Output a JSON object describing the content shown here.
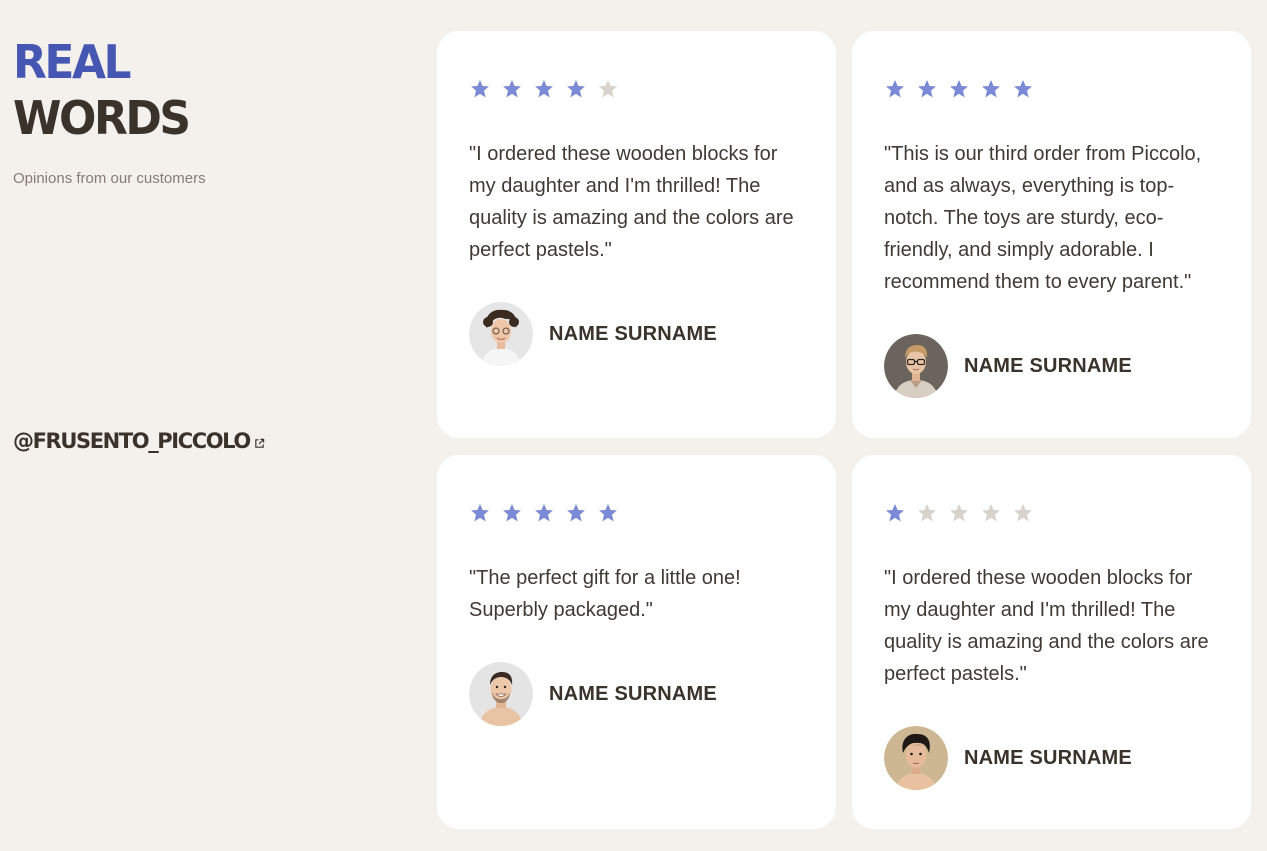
{
  "colors": {
    "background": "#f4f0ec",
    "card": "#ffffff",
    "accent": "#4657b3",
    "star_filled": "#7b8ad6",
    "star_empty": "#d7d2cc",
    "text_dark": "#3a332c",
    "text_muted": "#857d76"
  },
  "intro": {
    "title_line1": "REAL",
    "title_line2": "WORDS",
    "subtitle": "Opinions from our customers"
  },
  "social": {
    "handle": "@FRUSENTO_PICCOLO",
    "icon": "external-link-icon"
  },
  "reviews": [
    {
      "rating": 4,
      "max_rating": 5,
      "quote": "\"I ordered these wooden blocks for my daughter and I'm thrilled! The quality is amazing and the colors are perfect pastels.\"",
      "author": "NAME SURNAME",
      "avatar": "avatar-curly-hair-woman"
    },
    {
      "rating": 5,
      "max_rating": 5,
      "quote": "\"This is our third order from Piccolo, and as always, everything is top-notch. The toys are sturdy, eco-friendly, and simply adorable. I recommend them to every parent.\"",
      "author": "NAME SURNAME",
      "avatar": "avatar-man-glasses"
    },
    {
      "rating": 5,
      "max_rating": 5,
      "quote": "\"The perfect gift for a little one! Superbly packaged.\"",
      "author": "NAME SURNAME",
      "avatar": "avatar-smiling-man"
    },
    {
      "rating": 1,
      "max_rating": 5,
      "quote": "\"I ordered these wooden blocks for my daughter and I'm thrilled! The quality is amazing and the colors are perfect pastels.\"",
      "author": "NAME SURNAME",
      "avatar": "avatar-dark-hair-man"
    }
  ]
}
